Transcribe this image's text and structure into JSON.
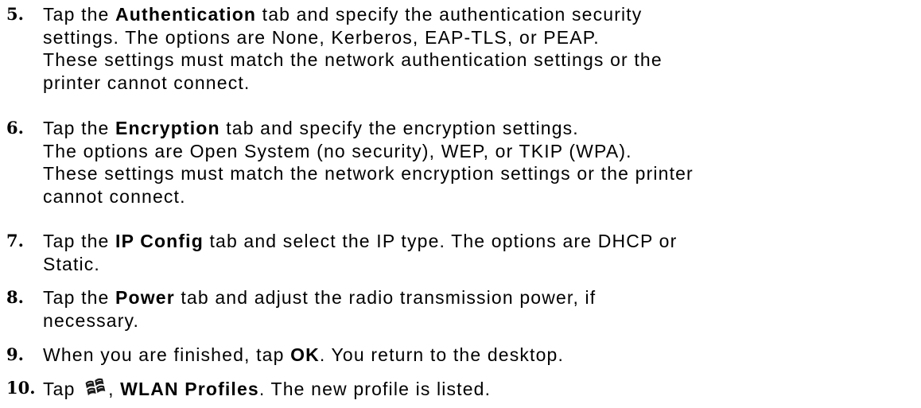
{
  "steps": [
    {
      "number": "5.",
      "lines": [
        {
          "pre": "Tap the ",
          "bold": "Authentication",
          "post": " tab and specify the authentication security"
        },
        {
          "text": "settings. The options are None, Kerberos, EAP-TLS, or PEAP."
        },
        {
          "text": "These settings must match the network authentication settings or the"
        },
        {
          "text": "printer cannot connect."
        }
      ]
    },
    {
      "number": "6.",
      "lines": [
        {
          "pre": "Tap the ",
          "bold": "Encryption",
          "post": " tab and specify the encryption settings."
        },
        {
          "text": "The options are Open System (no security), WEP, or TKIP (WPA)."
        },
        {
          "text": "These settings must match the network encryption settings or the printer"
        },
        {
          "text": "cannot connect."
        }
      ]
    },
    {
      "number": "7.",
      "lines": [
        {
          "pre": "Tap the ",
          "bold": "IP Config",
          "post": " tab and select the IP type. The options are DHCP or"
        },
        {
          "text": "Static."
        }
      ]
    },
    {
      "number": "8.",
      "lines": [
        {
          "pre": "Tap the ",
          "bold": "Power",
          "post": " tab and adjust the radio transmission power, if"
        },
        {
          "text": "necessary."
        }
      ]
    },
    {
      "number": "9.",
      "lines": [
        {
          "pre": "When you are finished, tap ",
          "bold": "OK",
          "post": ". You return to the desktop."
        }
      ]
    },
    {
      "number": "10.",
      "lines": [
        {
          "pre": "Tap ",
          "icon": "start-menu-icon",
          "mid": ", ",
          "bold": "WLAN Profiles",
          "post": ". The new profile is listed."
        }
      ]
    }
  ]
}
